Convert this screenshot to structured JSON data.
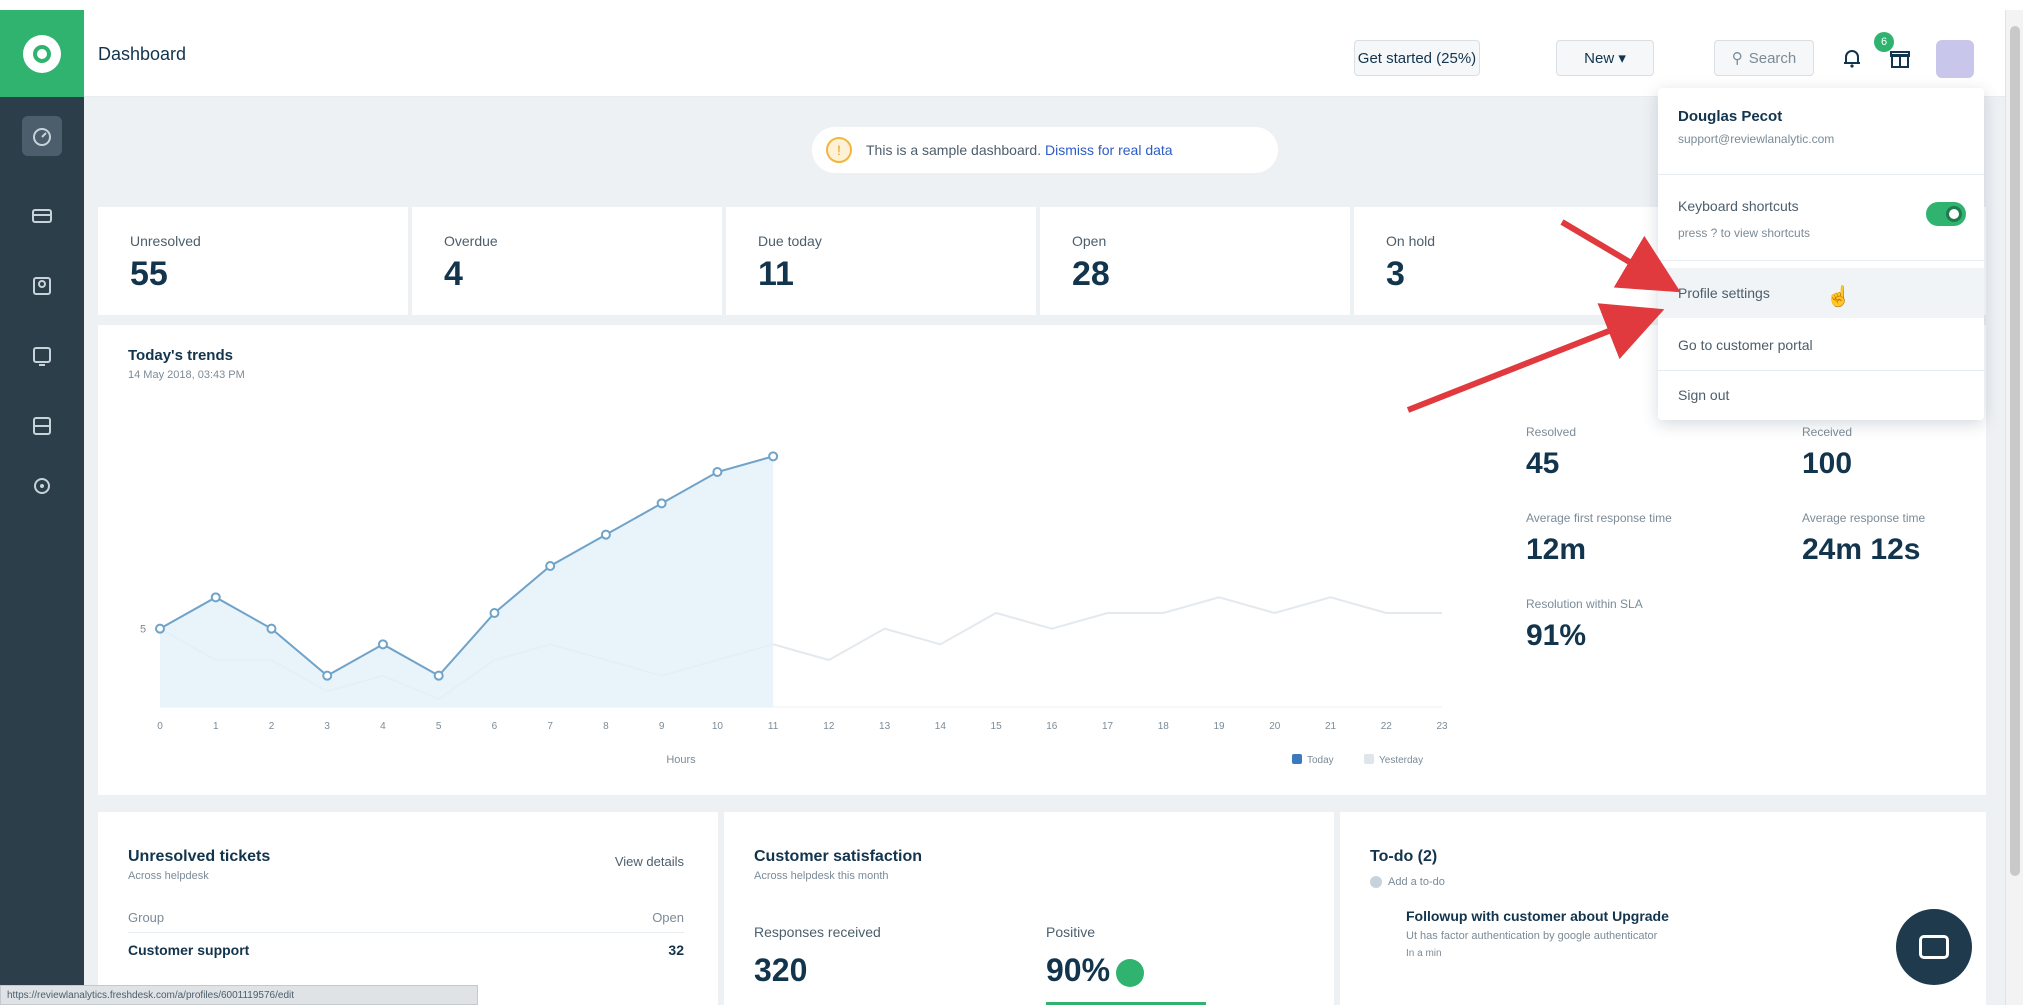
{
  "header": {
    "title": "Dashboard",
    "get_started": "Get started (25%)",
    "new_button": "New",
    "search_placeholder": "Search",
    "notification_count": "6"
  },
  "banner": {
    "text": "This is a sample dashboard.",
    "link": "Dismiss for real data"
  },
  "stats": [
    {
      "label": "Unresolved",
      "value": "55"
    },
    {
      "label": "Overdue",
      "value": "4"
    },
    {
      "label": "Due today",
      "value": "11"
    },
    {
      "label": "Open",
      "value": "28"
    },
    {
      "label": "On hold",
      "value": "3"
    }
  ],
  "trends": {
    "title": "Today's trends",
    "subtitle": "14 May 2018, 03:43 PM",
    "metrics": [
      {
        "label": "Resolved",
        "value": "45"
      },
      {
        "label": "Received",
        "value": "100"
      },
      {
        "label": "Average first response time",
        "value": "12m"
      },
      {
        "label": "Average response time",
        "value": "24m 12s"
      },
      {
        "label": "Resolution within SLA",
        "value": "91%"
      }
    ]
  },
  "chart_data": {
    "type": "line",
    "xlabel": "Hours",
    "ylabel": "",
    "x": [
      0,
      1,
      2,
      3,
      4,
      5,
      6,
      7,
      8,
      9,
      10,
      11,
      12,
      13,
      14,
      15,
      16,
      17,
      18,
      19,
      20,
      21,
      22,
      23
    ],
    "x_tick_labels": [
      "0",
      "1",
      "2",
      "3",
      "4",
      "5",
      "6",
      "7",
      "8",
      "9",
      "10",
      "11",
      "12",
      "13",
      "14",
      "15",
      "16",
      "17",
      "18",
      "19",
      "20",
      "21",
      "22",
      "23"
    ],
    "y_tick_labels": [
      "5"
    ],
    "series": [
      {
        "name": "Today",
        "color": "#6fa3c9",
        "values": [
          5,
          7,
          5,
          2,
          4,
          2,
          6,
          9,
          11,
          13,
          15,
          16,
          null,
          null,
          null,
          null,
          null,
          null,
          null,
          null,
          null,
          null,
          null,
          null
        ]
      },
      {
        "name": "Yesterday",
        "color": "#e4e9ee",
        "values": [
          5,
          3,
          3,
          1,
          2,
          0.5,
          3,
          4,
          3,
          2,
          3,
          4,
          3,
          5,
          4,
          6,
          5,
          6,
          6,
          7,
          6,
          7,
          6,
          6
        ]
      }
    ],
    "legend": "bottom-right"
  },
  "unresolved": {
    "title": "Unresolved tickets",
    "subtitle": "Across helpdesk",
    "link": "View details",
    "col_group": "Group",
    "col_open": "Open",
    "row_group": "Customer support",
    "row_open": "32"
  },
  "satisfaction": {
    "title": "Customer satisfaction",
    "subtitle": "Across helpdesk this month",
    "responses_label": "Responses received",
    "responses_value": "320",
    "positive_label": "Positive",
    "positive_value": "90%"
  },
  "todo": {
    "title": "To-do (2)",
    "add": "Add a to-do",
    "item": "Followup with customer about Upgrade",
    "item_sub": "Ut has factor authentication by google authenticator",
    "item_due": "In a min"
  },
  "dropdown": {
    "name": "Douglas Pecot",
    "email": "support@reviewlanalytic.com",
    "keyboard_title": "Keyboard shortcuts",
    "keyboard_sub": "press ? to view shortcuts",
    "keyboard_on": true,
    "items": [
      "Profile settings",
      "Go to customer portal",
      "Sign out"
    ]
  },
  "status_url": "https://reviewlanalytics.freshdesk.com/a/profiles/6001119576/edit",
  "colors": {
    "brand": "#2fb36f",
    "sidebar": "#2d3e4b",
    "accent": "#2c5cc5",
    "annotation": "#e0393e"
  }
}
